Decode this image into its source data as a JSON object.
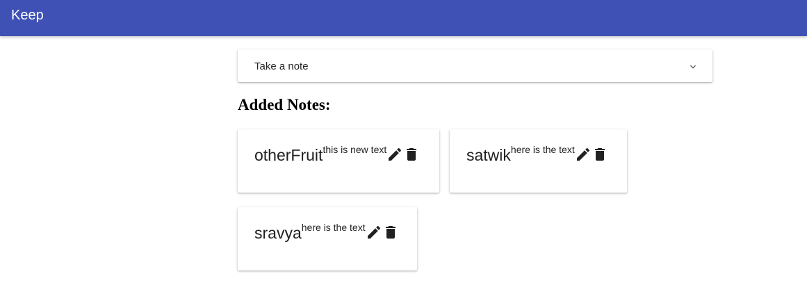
{
  "app": {
    "title": "Keep"
  },
  "note_input": {
    "placeholder": "Take a note",
    "expand_icon": "chevron-down-icon"
  },
  "section": {
    "title": "Added Notes:"
  },
  "notes": [
    {
      "title": "otherFruit",
      "text": "this is new text",
      "edit_icon": "pencil-icon",
      "delete_icon": "trash-icon"
    },
    {
      "title": "satwik",
      "text": "here is the text",
      "edit_icon": "pencil-icon",
      "delete_icon": "trash-icon"
    },
    {
      "title": "sravya",
      "text": "here is the text",
      "edit_icon": "pencil-icon",
      "delete_icon": "trash-icon"
    }
  ],
  "colors": {
    "appbar": "#3f51b5",
    "icon": "#212121"
  }
}
